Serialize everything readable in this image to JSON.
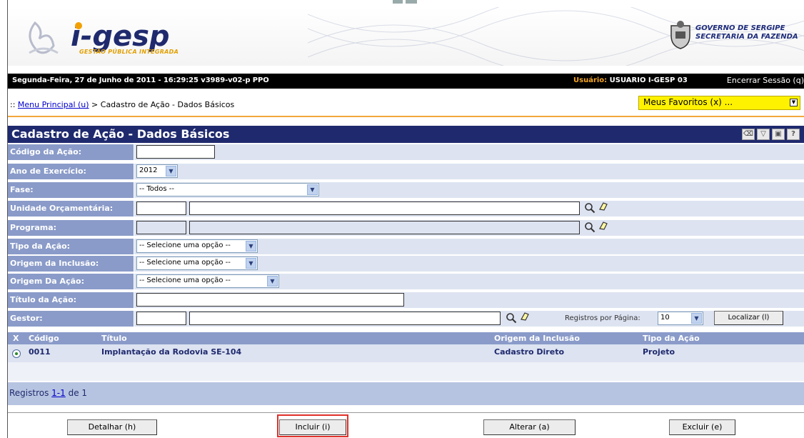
{
  "header": {
    "brand": "i-gesp",
    "brand_tagline": "GESTÃO PÚBLICA INTEGRADA",
    "gov_line1": "GOVERNO DE SERGIPE",
    "gov_line2": "SECRETARIA DA FAZENDA"
  },
  "infobar": {
    "date_version": "Segunda-Feira, 27 de Junho de 2011 - 16:29:25  v3989-v02-p  PPO",
    "user_label": "Usuário: ",
    "user_value": "USUARIO I-GESP 03",
    "logout": "Encerrar Sessão (q)"
  },
  "breadcrumb": {
    "prefix": ":: ",
    "home": "Menu Principal (u)",
    "separator": " > ",
    "current": "Cadastro de Ação - Dados Básicos"
  },
  "favorites": {
    "label": "Meus Favoritos (x) ..."
  },
  "title": "Cadastro de Ação - Dados Básicos",
  "form": {
    "codigo": {
      "label": "Código da Ação:",
      "value": ""
    },
    "ano": {
      "label": "Ano de Exercício:",
      "value": "2012"
    },
    "fase": {
      "label": "Fase:",
      "value": "-- Todos --"
    },
    "unidade": {
      "label": "Unidade Orçamentária:"
    },
    "programa": {
      "label": "Programa:"
    },
    "tipo": {
      "label": "Tipo da Ação:",
      "value": "-- Selecione uma opção --"
    },
    "origem_inclusao": {
      "label": "Origem da Inclusão:",
      "value": "-- Selecione uma opção --"
    },
    "origem_acao": {
      "label": "Origem Da Ação:",
      "value": "-- Selecione uma opção --"
    },
    "titulo": {
      "label": "Título da Ação:",
      "value": ""
    },
    "gestor": {
      "label": "Gestor:"
    },
    "registros_label": "Registros por Página:",
    "registros_value": "10",
    "localizar": "Localizar (l)"
  },
  "results": {
    "headers": {
      "x": "X",
      "codigo": "Código",
      "titulo": "Título",
      "origem": "Origem da Inclusão",
      "tipo": "Tipo da Ação"
    },
    "rows": [
      {
        "codigo": "0011",
        "titulo": "Implantação da Rodovia SE-104",
        "origem": "Cadastro Direto",
        "tipo": "Projeto"
      }
    ],
    "footer_prefix": "Registros ",
    "footer_range": "1-1",
    "footer_suffix": " de 1"
  },
  "actions": {
    "detalhar": "Detalhar (h)",
    "incluir": "Incluir (i)",
    "alterar": "Alterar (a)",
    "excluir": "Excluir (e)"
  },
  "colors": {
    "title_bar": "#1f2a6e",
    "label_cell": "#8a9bc9",
    "value_cell": "#dde3f1",
    "favorites": "#fff200",
    "highlight": "#e0302a"
  }
}
